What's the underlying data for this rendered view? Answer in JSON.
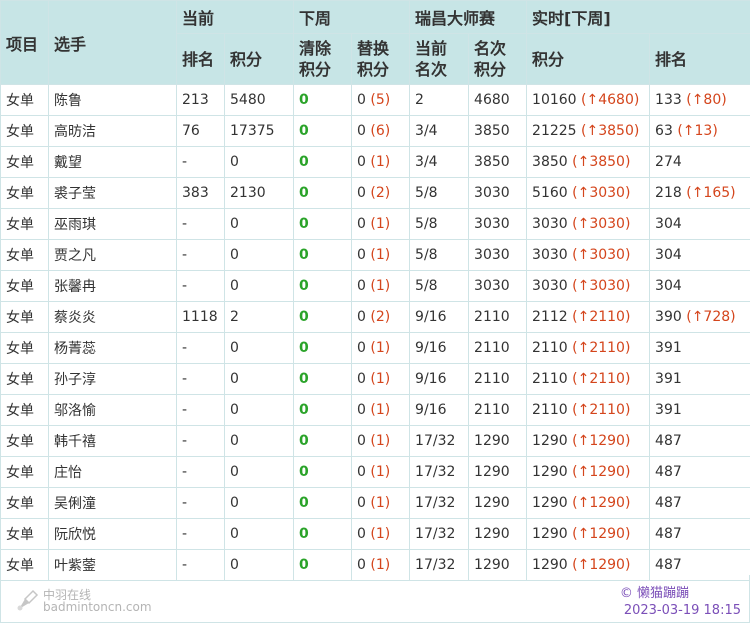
{
  "header": {
    "col_event": "项目",
    "col_player": "选手",
    "group_current": "当前",
    "group_next_week": "下周",
    "group_tournament": "瑞昌大师赛",
    "group_realtime": "实时[下周]",
    "sub_rank": "排名",
    "sub_points": "积分",
    "sub_clear_points": "清除积分",
    "sub_replace_points": "替换积分",
    "sub_current_place": "当前名次",
    "sub_place_points": "名次积分",
    "sub_rt_points": "积分",
    "sub_rt_rank": "排名"
  },
  "rows": [
    {
      "event": "女单",
      "player": "陈鲁",
      "rank": "213",
      "points": "5480",
      "clear": "0",
      "replace": "0",
      "replace_paren": "(5)",
      "place": "2",
      "place_points": "4680",
      "rt_points": "10160",
      "rt_points_delta": "(↑4680)",
      "rt_rank": "133",
      "rt_rank_delta": "(↑80)"
    },
    {
      "event": "女单",
      "player": "高昉洁",
      "rank": "76",
      "points": "17375",
      "clear": "0",
      "replace": "0",
      "replace_paren": "(6)",
      "place": "3/4",
      "place_points": "3850",
      "rt_points": "21225",
      "rt_points_delta": "(↑3850)",
      "rt_rank": "63",
      "rt_rank_delta": "(↑13)"
    },
    {
      "event": "女单",
      "player": "戴望",
      "rank": "-",
      "points": "0",
      "clear": "0",
      "replace": "0",
      "replace_paren": "(1)",
      "place": "3/4",
      "place_points": "3850",
      "rt_points": "3850",
      "rt_points_delta": "(↑3850)",
      "rt_rank": "274",
      "rt_rank_delta": ""
    },
    {
      "event": "女单",
      "player": "裘子莹",
      "rank": "383",
      "points": "2130",
      "clear": "0",
      "replace": "0",
      "replace_paren": "(2)",
      "place": "5/8",
      "place_points": "3030",
      "rt_points": "5160",
      "rt_points_delta": "(↑3030)",
      "rt_rank": "218",
      "rt_rank_delta": "(↑165)"
    },
    {
      "event": "女单",
      "player": "巫雨琪",
      "rank": "-",
      "points": "0",
      "clear": "0",
      "replace": "0",
      "replace_paren": "(1)",
      "place": "5/8",
      "place_points": "3030",
      "rt_points": "3030",
      "rt_points_delta": "(↑3030)",
      "rt_rank": "304",
      "rt_rank_delta": ""
    },
    {
      "event": "女单",
      "player": "贾之凡",
      "rank": "-",
      "points": "0",
      "clear": "0",
      "replace": "0",
      "replace_paren": "(1)",
      "place": "5/8",
      "place_points": "3030",
      "rt_points": "3030",
      "rt_points_delta": "(↑3030)",
      "rt_rank": "304",
      "rt_rank_delta": ""
    },
    {
      "event": "女单",
      "player": "张馨冉",
      "rank": "-",
      "points": "0",
      "clear": "0",
      "replace": "0",
      "replace_paren": "(1)",
      "place": "5/8",
      "place_points": "3030",
      "rt_points": "3030",
      "rt_points_delta": "(↑3030)",
      "rt_rank": "304",
      "rt_rank_delta": ""
    },
    {
      "event": "女单",
      "player": "蔡炎炎",
      "rank": "1118",
      "points": "2",
      "clear": "0",
      "replace": "0",
      "replace_paren": "(2)",
      "place": "9/16",
      "place_points": "2110",
      "rt_points": "2112",
      "rt_points_delta": "(↑2110)",
      "rt_rank": "390",
      "rt_rank_delta": "(↑728)"
    },
    {
      "event": "女单",
      "player": "杨菁蕊",
      "rank": "-",
      "points": "0",
      "clear": "0",
      "replace": "0",
      "replace_paren": "(1)",
      "place": "9/16",
      "place_points": "2110",
      "rt_points": "2110",
      "rt_points_delta": "(↑2110)",
      "rt_rank": "391",
      "rt_rank_delta": ""
    },
    {
      "event": "女单",
      "player": "孙子淳",
      "rank": "-",
      "points": "0",
      "clear": "0",
      "replace": "0",
      "replace_paren": "(1)",
      "place": "9/16",
      "place_points": "2110",
      "rt_points": "2110",
      "rt_points_delta": "(↑2110)",
      "rt_rank": "391",
      "rt_rank_delta": ""
    },
    {
      "event": "女单",
      "player": "邬洛愉",
      "rank": "-",
      "points": "0",
      "clear": "0",
      "replace": "0",
      "replace_paren": "(1)",
      "place": "9/16",
      "place_points": "2110",
      "rt_points": "2110",
      "rt_points_delta": "(↑2110)",
      "rt_rank": "391",
      "rt_rank_delta": ""
    },
    {
      "event": "女单",
      "player": "韩千禧",
      "rank": "-",
      "points": "0",
      "clear": "0",
      "replace": "0",
      "replace_paren": "(1)",
      "place": "17/32",
      "place_points": "1290",
      "rt_points": "1290",
      "rt_points_delta": "(↑1290)",
      "rt_rank": "487",
      "rt_rank_delta": ""
    },
    {
      "event": "女单",
      "player": "庄怡",
      "rank": "-",
      "points": "0",
      "clear": "0",
      "replace": "0",
      "replace_paren": "(1)",
      "place": "17/32",
      "place_points": "1290",
      "rt_points": "1290",
      "rt_points_delta": "(↑1290)",
      "rt_rank": "487",
      "rt_rank_delta": ""
    },
    {
      "event": "女单",
      "player": "吴俐潼",
      "rank": "-",
      "points": "0",
      "clear": "0",
      "replace": "0",
      "replace_paren": "(1)",
      "place": "17/32",
      "place_points": "1290",
      "rt_points": "1290",
      "rt_points_delta": "(↑1290)",
      "rt_rank": "487",
      "rt_rank_delta": ""
    },
    {
      "event": "女单",
      "player": "阮欣悦",
      "rank": "-",
      "points": "0",
      "clear": "0",
      "replace": "0",
      "replace_paren": "(1)",
      "place": "17/32",
      "place_points": "1290",
      "rt_points": "1290",
      "rt_points_delta": "(↑1290)",
      "rt_rank": "487",
      "rt_rank_delta": ""
    },
    {
      "event": "女单",
      "player": "叶紫蓥",
      "rank": "-",
      "points": "0",
      "clear": "0",
      "replace": "0",
      "replace_paren": "(1)",
      "place": "17/32",
      "place_points": "1290",
      "rt_points": "1290",
      "rt_points_delta": "(↑1290)",
      "rt_rank": "487",
      "rt_rank_delta": ""
    }
  ],
  "footer": {
    "logo_cn": "中羽在线",
    "logo_en": "badmintoncn.com",
    "copyright": "© 懒猫蹦蹦",
    "timestamp": "2023-03-19 18:15"
  },
  "colors": {
    "header_bg": "#c7e5e6",
    "border": "#cfe4e6",
    "zero_green": "#2aa329",
    "delta_red": "#d4451c",
    "credit_purple": "#7b4fb8"
  }
}
